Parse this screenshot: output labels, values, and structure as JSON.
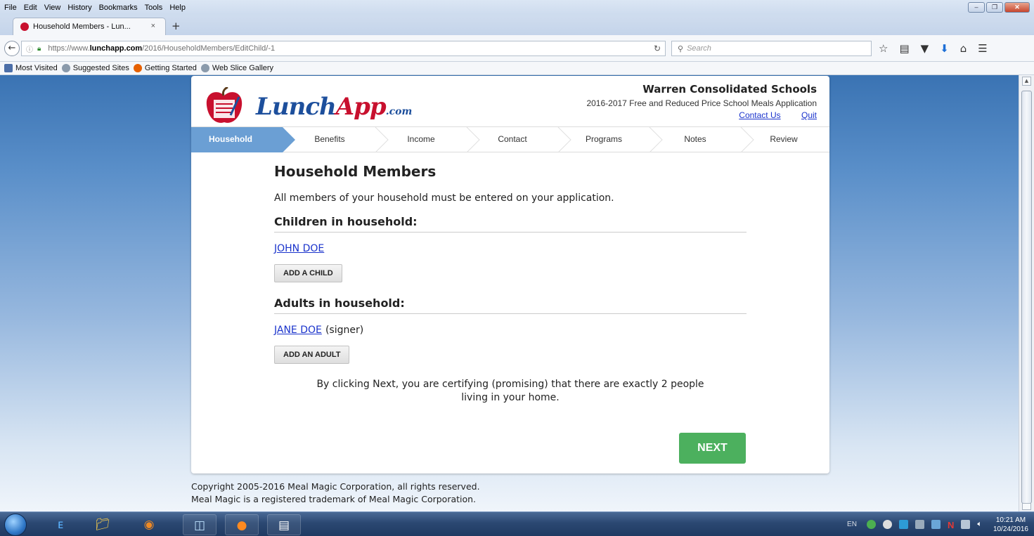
{
  "browser": {
    "menu": [
      "File",
      "Edit",
      "View",
      "History",
      "Bookmarks",
      "Tools",
      "Help"
    ],
    "tab_title": "Household Members - Lun...",
    "tab_close": "×",
    "new_tab": "+",
    "url_prefix": "https://www.",
    "url_domain": "lunchapp.com",
    "url_path": "/2016/HouseholdMembers/EditChild/-1",
    "search_placeholder": "Search",
    "bookmarks": [
      "Most Visited",
      "Suggested Sites",
      "Getting Started",
      "Web Slice Gallery"
    ]
  },
  "header": {
    "logo_word1": "Lunch",
    "logo_word2": "App",
    "logo_suffix": ".com",
    "school_name": "Warren Consolidated Schools",
    "app_title": "2016-2017 Free and Reduced Price School Meals Application",
    "contact_link": "Contact Us",
    "quit_link": "Quit"
  },
  "steps": [
    {
      "label": "Household",
      "active": true
    },
    {
      "label": "Benefits",
      "active": false
    },
    {
      "label": "Income",
      "active": false
    },
    {
      "label": "Contact",
      "active": false
    },
    {
      "label": "Programs",
      "active": false
    },
    {
      "label": "Notes",
      "active": false
    },
    {
      "label": "Review",
      "active": false
    }
  ],
  "main": {
    "title": "Household Members",
    "intro": "All members of your household must be entered on your application.",
    "children_heading": "Children in household:",
    "children": [
      {
        "name": "JOHN DOE"
      }
    ],
    "add_child": "ADD A CHILD",
    "adults_heading": "Adults in household:",
    "adults": [
      {
        "name": "JANE DOE",
        "note": "(signer)"
      }
    ],
    "add_adult": "ADD AN ADULT",
    "certify_line1": "By clicking Next, you are certifying (promising) that there are exactly 2 people",
    "certify_line2": "living in your home.",
    "next": "NEXT"
  },
  "footer": {
    "copyright": "Copyright 2005-2016 Meal Magic Corporation, all rights reserved.",
    "trademark": "Meal Magic is a registered trademark of Meal Magic Corporation."
  },
  "taskbar": {
    "language": "EN",
    "time": "10:21 AM",
    "date": "10/24/2016"
  },
  "colors": {
    "step_active": "#6b9fd4",
    "next_button": "#4cb05e",
    "link": "#1a33cc",
    "logo_blue": "#1d4f9c",
    "logo_red": "#c8102e"
  }
}
